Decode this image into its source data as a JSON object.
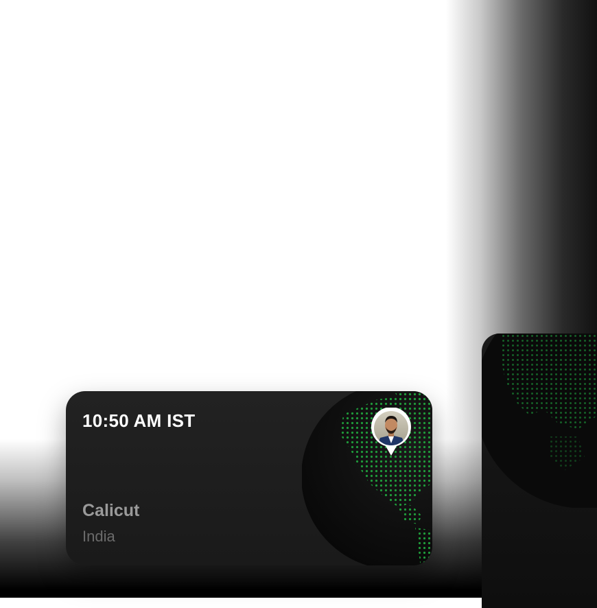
{
  "widget": {
    "time": "10:50 AM IST",
    "city": "Calicut",
    "country": "India"
  },
  "colors": {
    "card_bg": "#1f1f1f",
    "time_text": "#ffffff",
    "city_text": "#9a9a9a",
    "country_text": "#6b6b6b",
    "map_dots": "#1f9a3a"
  },
  "icons": {
    "globe": "globe-icon",
    "location_pin": "map-pin-avatar"
  }
}
